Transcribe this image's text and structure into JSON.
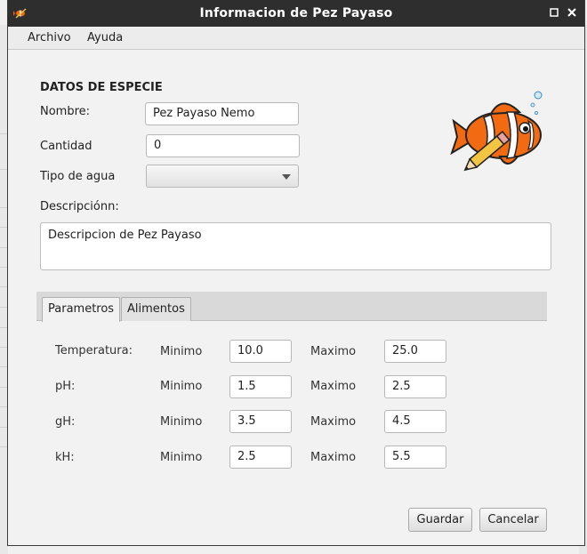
{
  "window": {
    "title": "Informacion de Pez Payaso"
  },
  "menu": [
    "Archivo",
    "Ayuda"
  ],
  "form": {
    "section_title": "DATOS DE ESPECIE",
    "nombre_label": "Nombre:",
    "nombre_value": "Pez Payaso Nemo",
    "cantidad_label": "Cantidad",
    "cantidad_value": "0",
    "tipo_agua_label": "Tipo de agua",
    "tipo_agua_value": "",
    "descripcion_label": "Descripciónn:",
    "descripcion_value": "Descripcion de Pez Payaso"
  },
  "tabs": [
    {
      "label": "Parametros",
      "active": true
    },
    {
      "label": "Alimentos",
      "active": false
    }
  ],
  "params": {
    "min_label": "Minimo",
    "max_label": "Maximo",
    "rows": [
      {
        "name": "Temperatura:",
        "min": "10.0",
        "max": "25.0"
      },
      {
        "name": "pH:",
        "min": "1.5",
        "max": "2.5"
      },
      {
        "name": "gH:",
        "min": "3.5",
        "max": "4.5"
      },
      {
        "name": "kH:",
        "min": "2.5",
        "max": "5.5"
      }
    ]
  },
  "buttons": {
    "guardar": "Guardar",
    "cancelar": "Cancelar"
  },
  "icons": {
    "app_icon": "fish-app-icon",
    "maximize": "maximize-icon",
    "close": "close-icon",
    "dropdown": "chevron-down-icon",
    "illustration": "clownfish-pencil-icon"
  },
  "colors": {
    "titlebar": "#2e2e2e",
    "fish_orange": "#f26a12",
    "window_bg": "#f2f2f2"
  }
}
